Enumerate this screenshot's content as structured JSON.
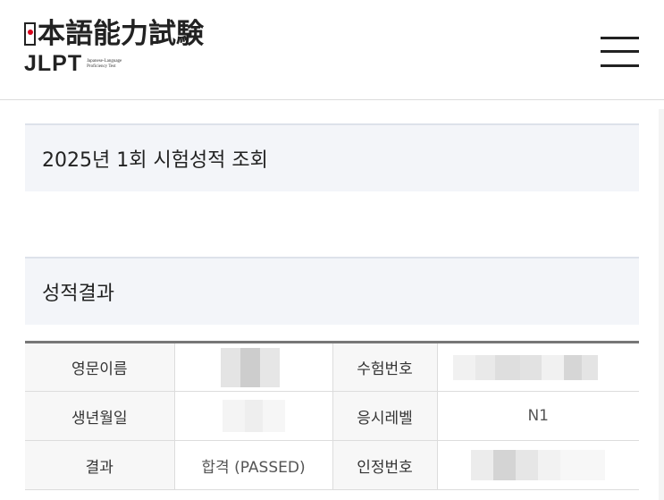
{
  "header": {
    "logo_jp": "本語能力試験",
    "logo_en": "JLPT",
    "logo_en_small": "Japanese-Language Proficiency Test"
  },
  "sections": {
    "exam_title": "2025년 1회 시험성적 조회",
    "result_title": "성적결과"
  },
  "table": {
    "rows": [
      {
        "label1": "영문이름",
        "value1": "",
        "label2": "수험번호",
        "value2": ""
      },
      {
        "label1": "생년월일",
        "value1": "",
        "label2": "응시레벨",
        "value2": "N1"
      },
      {
        "label1": "결과",
        "value1": "합격 (PASSED)",
        "label2": "인정번호",
        "value2": ""
      }
    ]
  },
  "colors": {
    "section_bg": "#f3f5f9",
    "logo_red": "#d9001b",
    "table_header_bg": "#f7f7f7"
  },
  "icons": {
    "menu": "hamburger-menu-icon"
  }
}
